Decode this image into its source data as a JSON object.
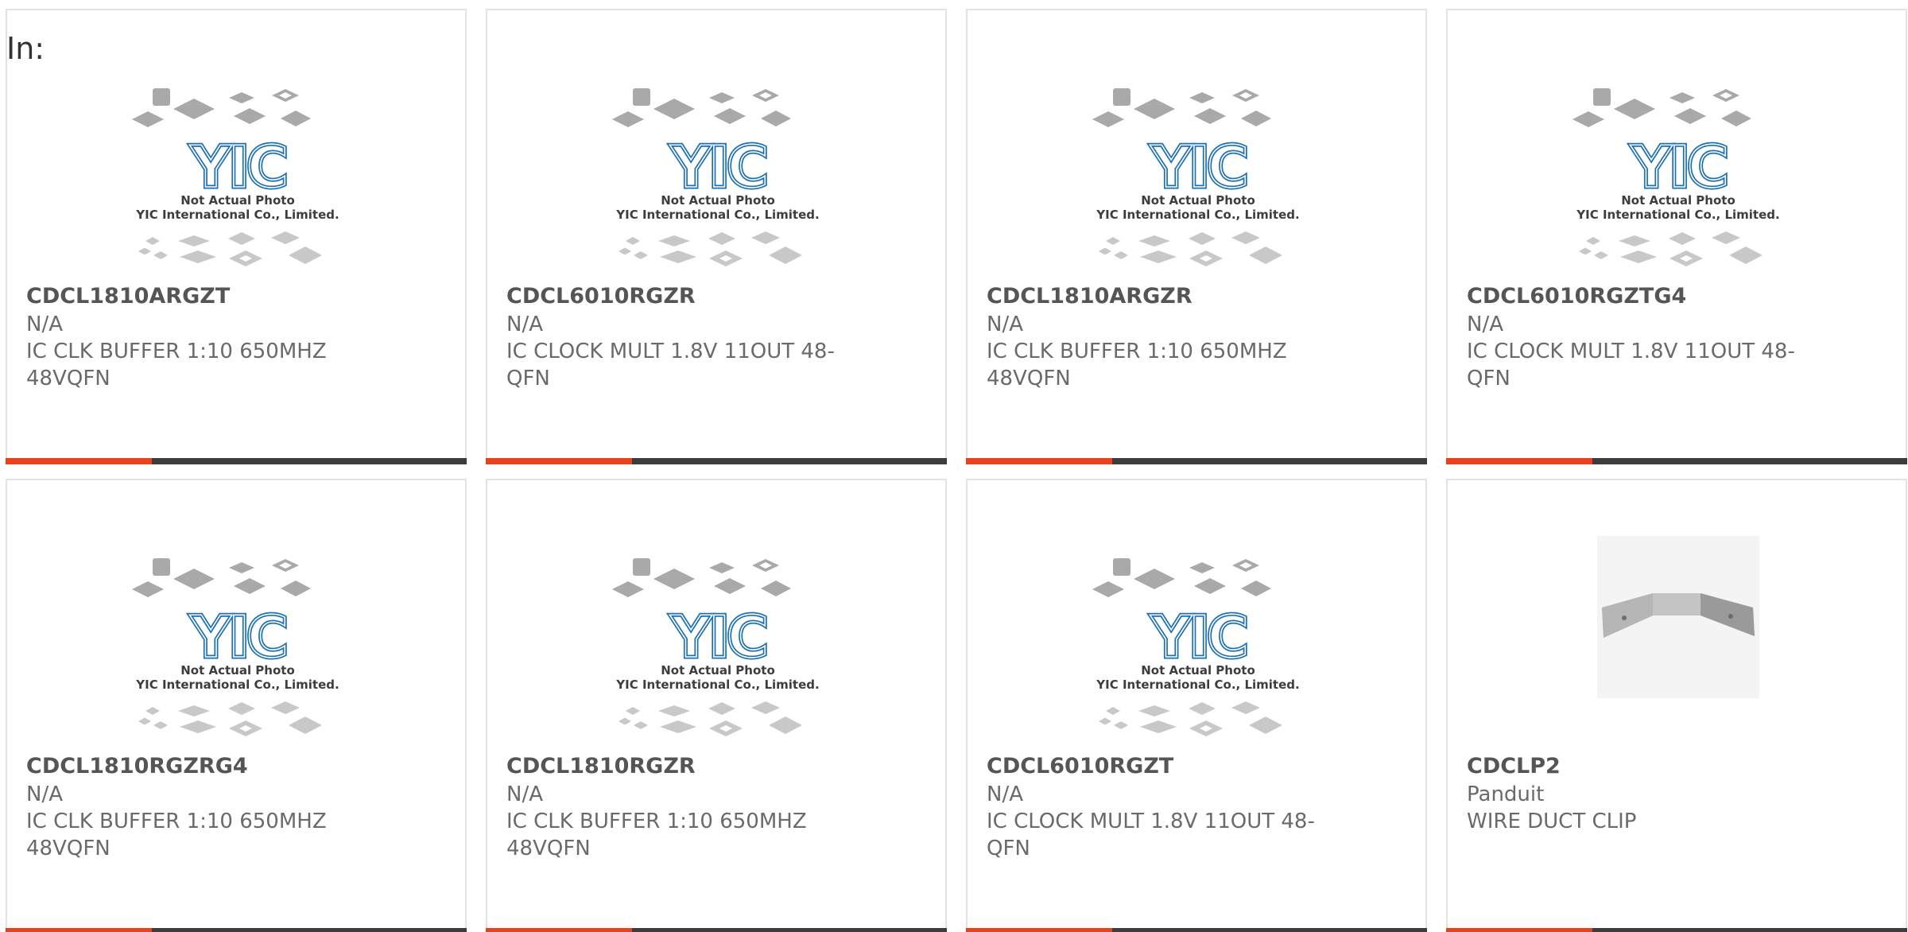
{
  "page": {
    "in_label": "In:"
  },
  "placeholder_image": {
    "logo_text": "YIC",
    "caption_line1": "Not Actual Photo",
    "caption_line2": "YIC International Co., Limited."
  },
  "products": [
    {
      "part_number": "CDCL1810ARGZT",
      "manufacturer": "N/A",
      "description": "IC CLK BUFFER 1:10 650MHZ 48VQFN",
      "image": "placeholder"
    },
    {
      "part_number": "CDCL6010RGZR",
      "manufacturer": "N/A",
      "description": "IC CLOCK MULT 1.8V 11OUT 48-QFN",
      "image": "placeholder"
    },
    {
      "part_number": "CDCL1810ARGZR",
      "manufacturer": "N/A",
      "description": "IC CLK BUFFER 1:10 650MHZ 48VQFN",
      "image": "placeholder"
    },
    {
      "part_number": "CDCL6010RGZTG4",
      "manufacturer": "N/A",
      "description": "IC CLOCK MULT 1.8V 11OUT 48-QFN",
      "image": "placeholder"
    },
    {
      "part_number": "CDCL1810RGZRG4",
      "manufacturer": "N/A",
      "description": "IC CLK BUFFER 1:10 650MHZ 48VQFN",
      "image": "placeholder"
    },
    {
      "part_number": "CDCL1810RGZR",
      "manufacturer": "N/A",
      "description": "IC CLK BUFFER 1:10 650MHZ 48VQFN",
      "image": "placeholder"
    },
    {
      "part_number": "CDCL6010RGZT",
      "manufacturer": "N/A",
      "description": "IC CLOCK MULT 1.8V 11OUT 48-QFN",
      "image": "placeholder"
    },
    {
      "part_number": "CDCLP2",
      "manufacturer": "Panduit",
      "description": "WIRE DUCT CLIP",
      "image": "photo"
    }
  ],
  "colors": {
    "accent": "#e8421c",
    "bar": "#3d3d3d",
    "border": "#e3e3e3",
    "logo_blue": "#1a6fb5"
  }
}
